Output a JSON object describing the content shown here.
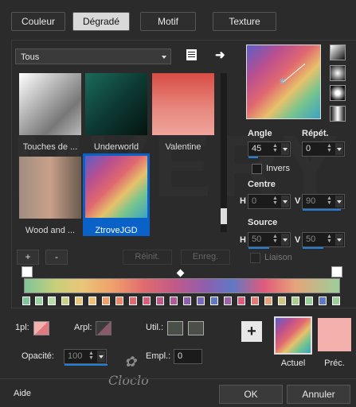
{
  "tabs": [
    "Couleur",
    "Dégradé",
    "Motif",
    "Texture"
  ],
  "active_tab": "Dégradé",
  "category": "Tous",
  "gradients": [
    {
      "label": "Touches de ..."
    },
    {
      "label": "Underworld"
    },
    {
      "label": "Valentine"
    },
    {
      "label": "Wood and ..."
    },
    {
      "label": "ZtroveJGD"
    }
  ],
  "selected_gradient": "ZtroveJGD",
  "list_buttons": {
    "add": "+",
    "remove": "-",
    "reset": "Réinit.",
    "save": "Enreg."
  },
  "angle": {
    "label": "Angle",
    "value": "45"
  },
  "repeat": {
    "label": "Répét.",
    "value": "0"
  },
  "invert": {
    "label": "Invers"
  },
  "center": {
    "label": "Centre",
    "h_label": "H",
    "h": "0",
    "v_label": "V",
    "v": "90"
  },
  "source": {
    "label": "Source",
    "h_label": "H",
    "h": "50",
    "v_label": "V",
    "v": "50"
  },
  "link": {
    "label": "Liaison"
  },
  "stops": {
    "pl_label": "1pl:",
    "arpl_label": "Arpl:",
    "util_label": "Util.:",
    "opacity_label": "Opacité:",
    "opacity_value": "100",
    "empl_label": "Empl.:",
    "empl_value": "0"
  },
  "preview": {
    "current_label": "Actuel",
    "previous_label": "Préc.",
    "add_symbol": "+"
  },
  "footer": {
    "help": "Aide",
    "ok": "OK",
    "cancel": "Annuler"
  },
  "watermark": "Cloclo",
  "colors": {
    "accent": "#0a61c8",
    "background": "#2b2b2b",
    "previous_swatch": "#f4b0ad"
  }
}
